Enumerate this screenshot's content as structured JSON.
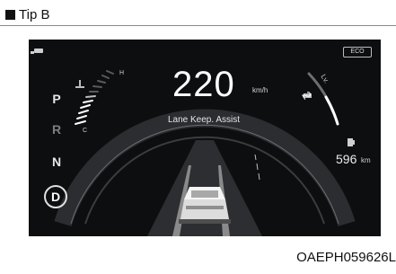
{
  "caption": {
    "marker": "■",
    "text": "Tip B"
  },
  "cluster": {
    "gears": [
      "P",
      "R",
      "N",
      "D"
    ],
    "selected_gear": "D",
    "speed": "220",
    "speed_unit": "km/h",
    "assist_message": "Lane Keep. Assist",
    "eco_badge": "ECO",
    "range": "596",
    "range_unit": "km",
    "temp_high": "H",
    "temp_low": "C",
    "level_prefix": "Lv.",
    "level": "2"
  },
  "figure_id": "OAEPH059626L",
  "colors": {
    "panel": "#0d0e0f",
    "text": "#ffffff",
    "dim": "#7d7d7d"
  },
  "icons": [
    "car-door-icon",
    "coolant-temp-icon",
    "fuel-pump-icon",
    "battery-icon",
    "gauge-arc-icon",
    "road-lane-icon",
    "vehicle-rear-icon"
  ]
}
